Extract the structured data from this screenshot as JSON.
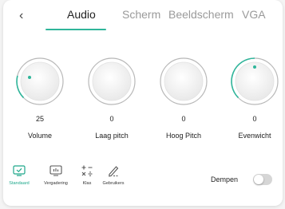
{
  "nav": {
    "back_glyph": "‹"
  },
  "tabs": [
    {
      "label": "Audio",
      "active": true
    },
    {
      "label": "Scherm",
      "active": false
    },
    {
      "label": "Beeldscherm",
      "active": false
    },
    {
      "label": "VGA",
      "active": false
    }
  ],
  "knobs": [
    {
      "label": "Volume",
      "value": "25"
    },
    {
      "label": "Laag pitch",
      "value": "0"
    },
    {
      "label": "Hoog Pitch",
      "value": "0"
    },
    {
      "label": "Evenwicht",
      "value": "0"
    }
  ],
  "modes": [
    {
      "label": "Standaard",
      "icon": "monitor-check-icon",
      "active": true
    },
    {
      "label": "Vergadering",
      "icon": "presentation-icon",
      "active": false
    },
    {
      "label": "Klas",
      "icon": "math-symbols-icon",
      "active": false
    },
    {
      "label": "Gebruikers",
      "icon": "pen-icon",
      "active": false
    }
  ],
  "mute": {
    "label": "Dempen",
    "on": false
  },
  "colors": {
    "accent": "#2fb59a",
    "inactive_tab": "#9a9a9a"
  }
}
